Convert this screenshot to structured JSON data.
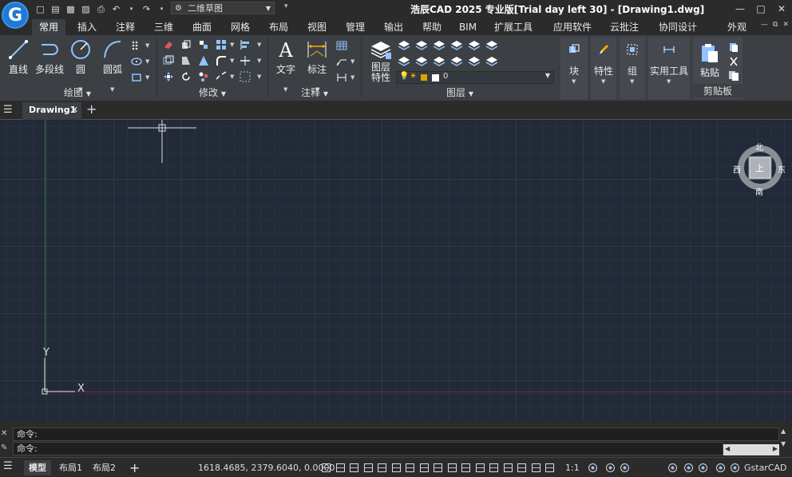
{
  "app": {
    "logo_letter": "G",
    "title": "浩辰CAD 2025 专业版[Trial day left 30] - [Drawing1.dwg]",
    "workspace": "二维草图"
  },
  "menu_tabs": [
    "常用",
    "插入",
    "注释",
    "三维",
    "曲面",
    "网格",
    "布局",
    "视图",
    "管理",
    "输出",
    "帮助",
    "BIM",
    "扩展工具",
    "应用软件",
    "云批注",
    "协同设计",
    "外观"
  ],
  "ribbon": {
    "draw": {
      "title": "绘图",
      "line": "直线",
      "polyline": "多段线",
      "circle": "圆",
      "arc": "圆弧"
    },
    "modify": {
      "title": "修改"
    },
    "annotation": {
      "title": "注释",
      "text": "文字",
      "dimension": "标注"
    },
    "layers": {
      "title": "图层",
      "layer_props_1": "图层",
      "layer_props_2": "特性",
      "current_layer": "0"
    },
    "block": {
      "label": "块"
    },
    "properties": {
      "label": "特性"
    },
    "group": {
      "label": "组"
    },
    "utilities": {
      "label": "实用工具"
    },
    "clipboard": {
      "title": "剪贴板",
      "paste": "粘贴"
    }
  },
  "document_tab": "Drawing1",
  "viewcube": {
    "north": "北",
    "south": "南",
    "east": "东",
    "west": "西",
    "top": "上"
  },
  "ucs": {
    "x": "X",
    "y": "Y"
  },
  "command": {
    "line1": "命令:",
    "line2": "命令:"
  },
  "status": {
    "layouts": [
      "模型",
      "布局1",
      "布局2"
    ],
    "coordinates": "1618.4685, 2379.6040, 0.0000",
    "scale": "1:1",
    "brand": "GstarCAD"
  },
  "colors": {
    "accent": "#1f79d6",
    "canvas": "#222a38",
    "y_axis": "#2f7a3a",
    "x_axis": "#7a2a2a"
  }
}
